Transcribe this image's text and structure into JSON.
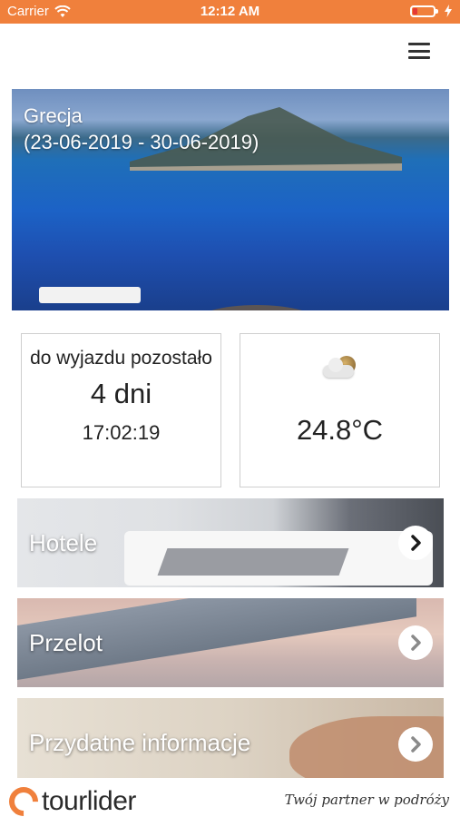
{
  "status_bar": {
    "carrier": "Carrier",
    "time": "12:12 AM",
    "battery_level": 0.15,
    "colors": {
      "background": "#f0803c",
      "battery_low": "#e53935"
    }
  },
  "header": {
    "menu_icon": "hamburger-menu-icon"
  },
  "hero": {
    "destination": "Grecja",
    "dates": "(23-06-2019 - 30-06-2019)"
  },
  "countdown": {
    "label": "do wyjazdu pozostało",
    "days": "4 dni",
    "time": "17:02:19"
  },
  "weather": {
    "icon": "partly-cloudy-icon",
    "temperature": "24.8°C"
  },
  "tiles": [
    {
      "label": "Hotele",
      "icon": "chevron-right-icon"
    },
    {
      "label": "Przelot",
      "icon": "chevron-right-icon"
    },
    {
      "label": "Przydatne informacje",
      "icon": "chevron-right-icon"
    }
  ],
  "footer": {
    "brand": "tourlider",
    "tagline": "Twój partner w podróży",
    "brand_color": "#f0803c"
  }
}
